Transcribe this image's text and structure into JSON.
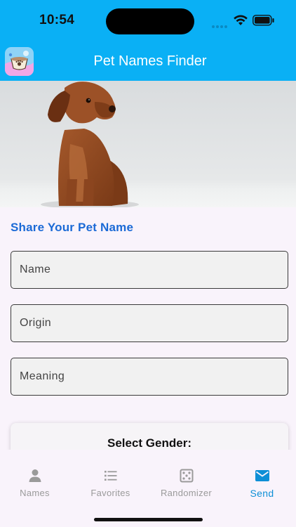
{
  "status_bar": {
    "time": "10:54"
  },
  "header": {
    "title": "Pet Names Finder",
    "icon": "pet-food-bowl-icon"
  },
  "hero": {
    "image": "dachshund-photo"
  },
  "form": {
    "section_title": "Share Your Pet Name",
    "fields": [
      {
        "placeholder": "Name",
        "value": ""
      },
      {
        "placeholder": "Origin",
        "value": ""
      },
      {
        "placeholder": "Meaning",
        "value": ""
      }
    ],
    "gender_title": "Select Gender:"
  },
  "tabs": [
    {
      "label": "Names",
      "icon": "person-icon",
      "active": false
    },
    {
      "label": "Favorites",
      "icon": "list-icon",
      "active": false
    },
    {
      "label": "Randomizer",
      "icon": "dice-icon",
      "active": false
    },
    {
      "label": "Send",
      "icon": "envelope-icon",
      "active": true
    }
  ],
  "colors": {
    "header": "#0ab0f5",
    "accent": "#1b6ad6",
    "active_tab": "#0e8fd6",
    "inactive_tab": "#9a9a9a",
    "background": "#f9f3fb"
  }
}
